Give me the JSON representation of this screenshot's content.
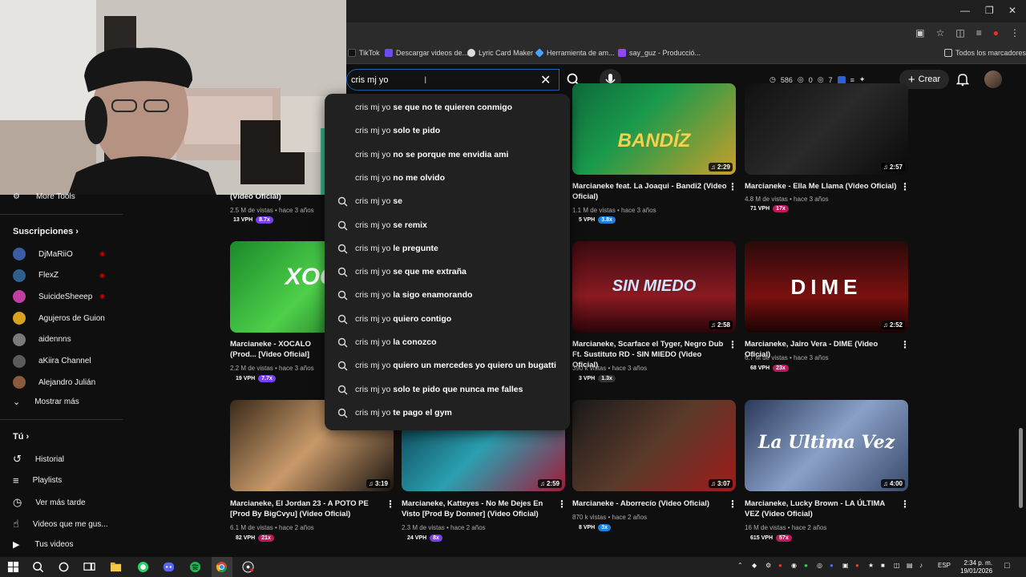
{
  "browser": {
    "bookmarks": [
      {
        "label": "TikTok",
        "color": "#111111"
      },
      {
        "label": "Descargar videos de...",
        "color": "#6c4cf1"
      },
      {
        "label": "Lyric Card Maker",
        "color": "#dddddd"
      },
      {
        "label": "Herramienta de am...",
        "color": "#4aa3ff"
      },
      {
        "label": "say_guz - Producció...",
        "color": "#9146ff"
      }
    ],
    "all_bookmarks": "Todos los marcadores"
  },
  "header": {
    "search_value": "cris mj yo",
    "stats": {
      "views": "586",
      "zero": "0",
      "seven": "7"
    },
    "create_label": "Crear"
  },
  "suggestions": [
    {
      "prefix": "cris mj yo",
      "rest": " se que no te quieren conmigo",
      "icon": "none"
    },
    {
      "prefix": "cris mj yo",
      "rest": " solo te pido",
      "icon": "none"
    },
    {
      "prefix": "cris mj yo",
      "rest": " no se porque me envidia ami",
      "icon": "none"
    },
    {
      "prefix": "cris mj yo",
      "rest": " no me olvido",
      "icon": "none"
    },
    {
      "prefix": "cris mj yo",
      "rest": " se",
      "icon": "search-icon"
    },
    {
      "prefix": "cris mj yo",
      "rest": " se remix",
      "icon": "search-icon"
    },
    {
      "prefix": "cris mj yo",
      "rest": " le pregunte",
      "icon": "search-icon"
    },
    {
      "prefix": "cris mj yo",
      "rest": " se que me extraña",
      "icon": "search-icon"
    },
    {
      "prefix": "cris mj yo",
      "rest": " la sigo enamorando",
      "icon": "search-icon"
    },
    {
      "prefix": "cris mj yo",
      "rest": " quiero contigo",
      "icon": "search-icon"
    },
    {
      "prefix": "cris mj yo",
      "rest": " la conozco",
      "icon": "search-icon"
    },
    {
      "prefix": "cris mj yo",
      "rest": " quiero un mercedes yo quiero un bugatti",
      "icon": "search-icon"
    },
    {
      "prefix": "cris mj yo",
      "rest": " solo te pido que nunca me falles",
      "icon": "search-icon"
    },
    {
      "prefix": "cris mj yo",
      "rest": " te pago el gym",
      "icon": "search-icon"
    }
  ],
  "sidebar": {
    "more_tools": "More Tools",
    "subscriptions_label": "Suscripciones",
    "subscriptions": [
      {
        "name": "DjMaRiiO",
        "live": true,
        "color": "#3b5ba5"
      },
      {
        "name": "FlexZ",
        "live": true,
        "color": "#2f5f8a"
      },
      {
        "name": "SuicideSheeep",
        "live": true,
        "color": "#c23ea3"
      },
      {
        "name": "Agujeros de Guion",
        "live": false,
        "color": "#d9a21b"
      },
      {
        "name": "aidennns",
        "live": false,
        "color": "#7a7a7a"
      },
      {
        "name": "aKiira Channel",
        "live": false,
        "color": "#5b5b5b"
      },
      {
        "name": "Alejandro Julián",
        "live": false,
        "color": "#8a5a3a"
      }
    ],
    "show_more": "Mostrar más",
    "you_label": "Tú",
    "you_items": [
      {
        "label": "Historial",
        "icon": "history-icon"
      },
      {
        "label": "Playlists",
        "icon": "playlist-icon"
      },
      {
        "label": "Ver más tarde",
        "icon": "clock-icon"
      },
      {
        "label": "Videos que me gus...",
        "icon": "like-icon"
      },
      {
        "label": "Tus videos",
        "icon": "video-icon"
      }
    ]
  },
  "videos": {
    "row1": [
      {
        "title_line": "(Video Oficial)",
        "meta": "2.5 M de vistas • hace 3 años",
        "vph": "13 VPH",
        "mult": "8.7x",
        "mult_color": "#7b3ff2"
      },
      {
        "title": "Marcianeke feat. La Joaqui - Bandi2 (Video Oficial)",
        "meta": "1.1 M de vistas • hace 3 años",
        "vph": "5 VPH",
        "mult": "3.8x",
        "mult_color": "#1d7fe0",
        "duration": "2:29",
        "thumb_text": "BANDÍZ"
      },
      {
        "title": "Marcianeke - Ella Me Llama (Video Oficial)",
        "meta": "4.8 M de vistas • hace 3 años",
        "vph": "71 VPH",
        "mult": "17x",
        "mult_color": "#c2185b",
        "duration": "2:57"
      }
    ],
    "row2": [
      {
        "title": "Marcianeke - XOCALO (Prod... [Video Oficial]",
        "meta": "2.2 M de vistas • hace 3 años",
        "vph": "19 VPH",
        "mult": "7.7x",
        "mult_color": "#7b3ff2",
        "thumb_text": "XOCA"
      },
      {
        "title": "Marcianeke, Scarface el Tyger, Negro Dub Ft. Sustituto RD - SIN MIEDO (Video Oficial)",
        "meta": "390 k vistas • hace 3 años",
        "vph": "3 VPH",
        "mult": "1.3x",
        "mult_color": "#333333",
        "duration": "2:58",
        "thumb_text": "SIN MIEDO"
      },
      {
        "title": "Marcianeke, Jairo Vera - DIME (Video Oficial)",
        "meta": "6.7 M de vistas • hace 3 años",
        "vph": "68 VPH",
        "mult": "23x",
        "mult_color": "#c2185b",
        "duration": "2:52",
        "thumb_text": "DIME"
      }
    ],
    "row3": [
      {
        "title": "Marcianeke, El Jordan 23 - A POTO PE [Prod By BigCvyu] (Video Oficial)",
        "meta": "6.1 M de vistas • hace 2 años",
        "vph": "82 VPH",
        "mult": "21x",
        "mult_color": "#c2185b",
        "duration": "3:19"
      },
      {
        "title": "Marcianeke, Katteyes - No Me Dejes En Visto [Prod By Donner] (Video Oficial)",
        "meta": "2.3 M de vistas • hace 2 años",
        "vph": "24 VPH",
        "mult": "8x",
        "mult_color": "#7b3ff2",
        "duration": "2:59"
      },
      {
        "title": "Marcianeke - Aborrecío (Video Oficial)",
        "meta": "870 k vistas • hace 2 años",
        "vph": "8 VPH",
        "mult": "3x",
        "mult_color": "#1d7fe0",
        "duration": "3:07"
      },
      {
        "title": "Marcianeke, Lucky Brown - LA ÚLTIMA VEZ (Video Oficial)",
        "meta": "16 M de vistas • hace 2 años",
        "vph": "615 VPH",
        "mult": "57x",
        "mult_color": "#c2185b",
        "duration": "4:00",
        "thumb_text": "La Ultima Vez"
      }
    ]
  },
  "taskbar": {
    "lang": "ESP",
    "time": "2:34 p. m.",
    "date": "19/01/2026"
  }
}
